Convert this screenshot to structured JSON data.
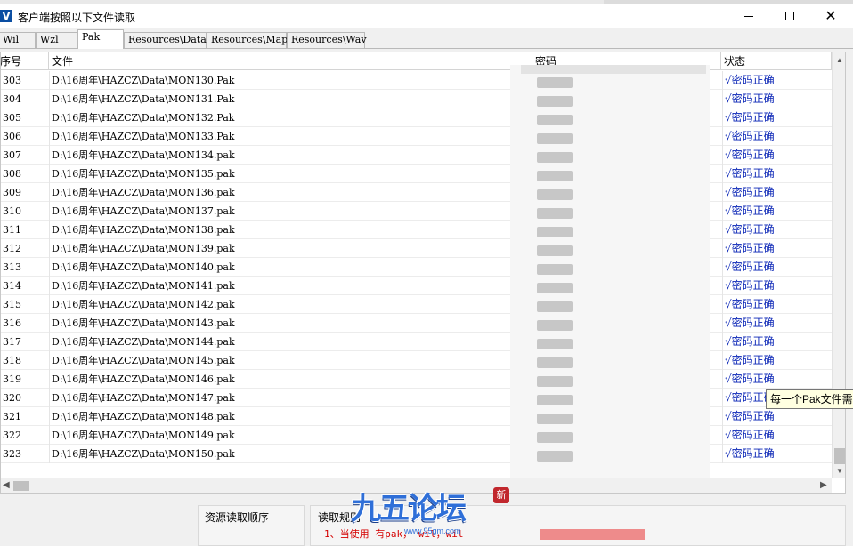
{
  "window": {
    "title": "客户端按照以下文件读取",
    "icon_letter": "V",
    "min_glyph": "",
    "close_glyph": "✕"
  },
  "tabs": [
    {
      "label": "Wil",
      "active": false
    },
    {
      "label": "Wzl",
      "active": false
    },
    {
      "label": "Pak",
      "active": true
    },
    {
      "label": "Resources\\Data",
      "active": false
    },
    {
      "label": "Resources\\Map",
      "active": false
    },
    {
      "label": "Resources\\Wav",
      "active": false
    }
  ],
  "columns": {
    "no": "序号",
    "file": "文件",
    "password": "密码",
    "status": "状态"
  },
  "rows": [
    {
      "no": "303",
      "file": "D:\\16周年\\HAZCZ\\Data\\MON130.Pak",
      "status": "√密码正确"
    },
    {
      "no": "304",
      "file": "D:\\16周年\\HAZCZ\\Data\\MON131.Pak",
      "status": "√密码正确"
    },
    {
      "no": "305",
      "file": "D:\\16周年\\HAZCZ\\Data\\MON132.Pak",
      "status": "√密码正确"
    },
    {
      "no": "306",
      "file": "D:\\16周年\\HAZCZ\\Data\\MON133.Pak",
      "status": "√密码正确"
    },
    {
      "no": "307",
      "file": "D:\\16周年\\HAZCZ\\Data\\MON134.pak",
      "status": "√密码正确"
    },
    {
      "no": "308",
      "file": "D:\\16周年\\HAZCZ\\Data\\MON135.pak",
      "status": "√密码正确"
    },
    {
      "no": "309",
      "file": "D:\\16周年\\HAZCZ\\Data\\MON136.pak",
      "status": "√密码正确"
    },
    {
      "no": "310",
      "file": "D:\\16周年\\HAZCZ\\Data\\MON137.pak",
      "status": "√密码正确"
    },
    {
      "no": "311",
      "file": "D:\\16周年\\HAZCZ\\Data\\MON138.pak",
      "status": "√密码正确"
    },
    {
      "no": "312",
      "file": "D:\\16周年\\HAZCZ\\Data\\MON139.pak",
      "status": "√密码正确"
    },
    {
      "no": "313",
      "file": "D:\\16周年\\HAZCZ\\Data\\MON140.pak",
      "status": "√密码正确"
    },
    {
      "no": "314",
      "file": "D:\\16周年\\HAZCZ\\Data\\MON141.pak",
      "status": "√密码正确"
    },
    {
      "no": "315",
      "file": "D:\\16周年\\HAZCZ\\Data\\MON142.pak",
      "status": "√密码正确"
    },
    {
      "no": "316",
      "file": "D:\\16周年\\HAZCZ\\Data\\MON143.pak",
      "status": "√密码正确"
    },
    {
      "no": "317",
      "file": "D:\\16周年\\HAZCZ\\Data\\MON144.pak",
      "status": "√密码正确"
    },
    {
      "no": "318",
      "file": "D:\\16周年\\HAZCZ\\Data\\MON145.pak",
      "status": "√密码正确"
    },
    {
      "no": "319",
      "file": "D:\\16周年\\HAZCZ\\Data\\MON146.pak",
      "status": "√密码正确"
    },
    {
      "no": "320",
      "file": "D:\\16周年\\HAZCZ\\Data\\MON147.pak",
      "status": "√密码正确"
    },
    {
      "no": "321",
      "file": "D:\\16周年\\HAZCZ\\Data\\MON148.pak",
      "status": "√密码正确"
    },
    {
      "no": "322",
      "file": "D:\\16周年\\HAZCZ\\Data\\MON149.pak",
      "status": "√密码正确"
    },
    {
      "no": "323",
      "file": "D:\\16周年\\HAZCZ\\Data\\MON150.pak",
      "status": "√密码正确"
    }
  ],
  "tooltip": "每一个Pak文件需要",
  "bottom": {
    "order_title": "资源读取顺序",
    "rules_title": "读取规则",
    "rule_line": "1、当使用    有pak，    wil，wil"
  },
  "watermark": {
    "text": "九五论坛",
    "badge": "新",
    "url": "www.95gm.com"
  },
  "colors": {
    "status_blue": "#0a25b6",
    "rule_red": "#d40000",
    "icon_blue": "#0b4ea2"
  }
}
